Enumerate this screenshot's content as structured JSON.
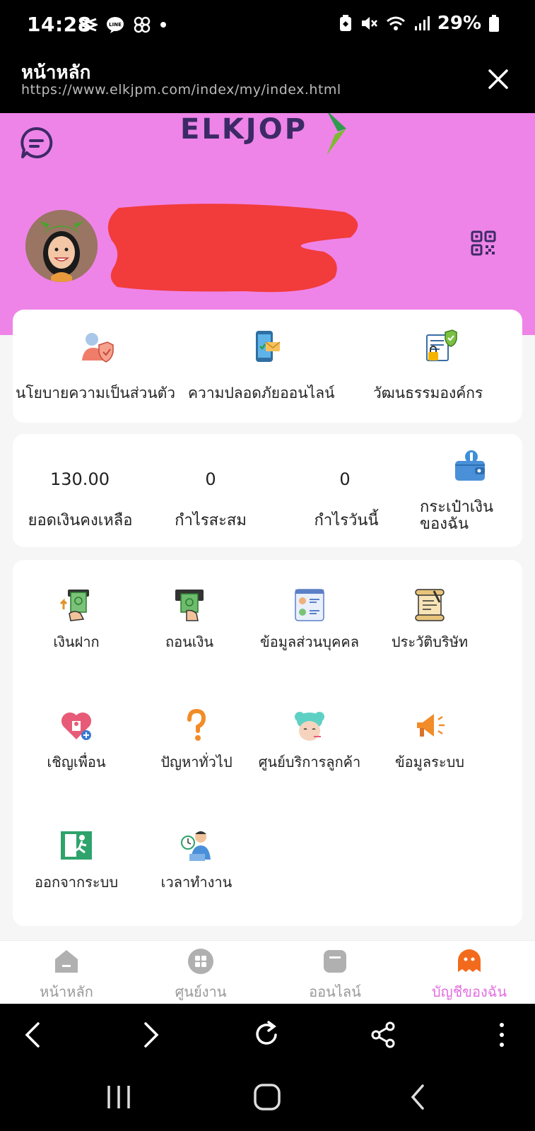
{
  "status_bar": {
    "time": "14:28",
    "battery": "29%"
  },
  "browser": {
    "title": "หน้าหลัก",
    "url": "https://www.elkjpm.com/index/my/index.html"
  },
  "header": {
    "logo_text": "ELKJOP"
  },
  "policies": [
    {
      "label": "นโยบายความเป็นส่วนตัว",
      "icon": "privacy-icon"
    },
    {
      "label": "ความปลอดภัยออนไลน์",
      "icon": "online-security-icon"
    },
    {
      "label": "วัฒนธรรมองค์กร",
      "icon": "corporate-culture-icon"
    }
  ],
  "stats": [
    {
      "value": "130.00",
      "label": "ยอดเงินคงเหลือ"
    },
    {
      "value": "0",
      "label": "กำไรสะสม"
    },
    {
      "value": "0",
      "label": "กำไรวันนี้"
    }
  ],
  "wallet": {
    "line1": "กระเป๋าเงิน",
    "line2": "ของฉัน"
  },
  "menu": [
    {
      "label": "เงินฝาก",
      "icon": "deposit-icon"
    },
    {
      "label": "ถอนเงิน",
      "icon": "withdraw-icon"
    },
    {
      "label": "ข้อมูลส่วนบุคคล",
      "icon": "personal-info-icon"
    },
    {
      "label": "ประวัติบริษัท",
      "icon": "company-history-icon"
    },
    {
      "label": "เชิญเพื่อน",
      "icon": "invite-friends-icon"
    },
    {
      "label": "ปัญหาทั่วไป",
      "icon": "faq-icon"
    },
    {
      "label": "ศูนย์บริการลูกค้า",
      "icon": "customer-service-icon"
    },
    {
      "label": "ข้อมูลระบบ",
      "icon": "system-info-icon"
    },
    {
      "label": "ออกจากระบบ",
      "icon": "logout-icon"
    },
    {
      "label": "เวลาทำงาน",
      "icon": "working-hours-icon"
    }
  ],
  "bottom_nav": [
    {
      "label": "หน้าหลัก",
      "icon": "home-icon"
    },
    {
      "label": "ศูนย์งาน",
      "icon": "task-center-icon"
    },
    {
      "label": "ออนไลน์",
      "icon": "online-icon"
    },
    {
      "label": "บัญชีของฉัน",
      "icon": "my-account-icon",
      "active": true
    }
  ],
  "colors": {
    "hero": "#ee84e8",
    "active_nav": "#e36ee0",
    "logo": "#3c2a66",
    "redaction": "#f23b3b"
  }
}
